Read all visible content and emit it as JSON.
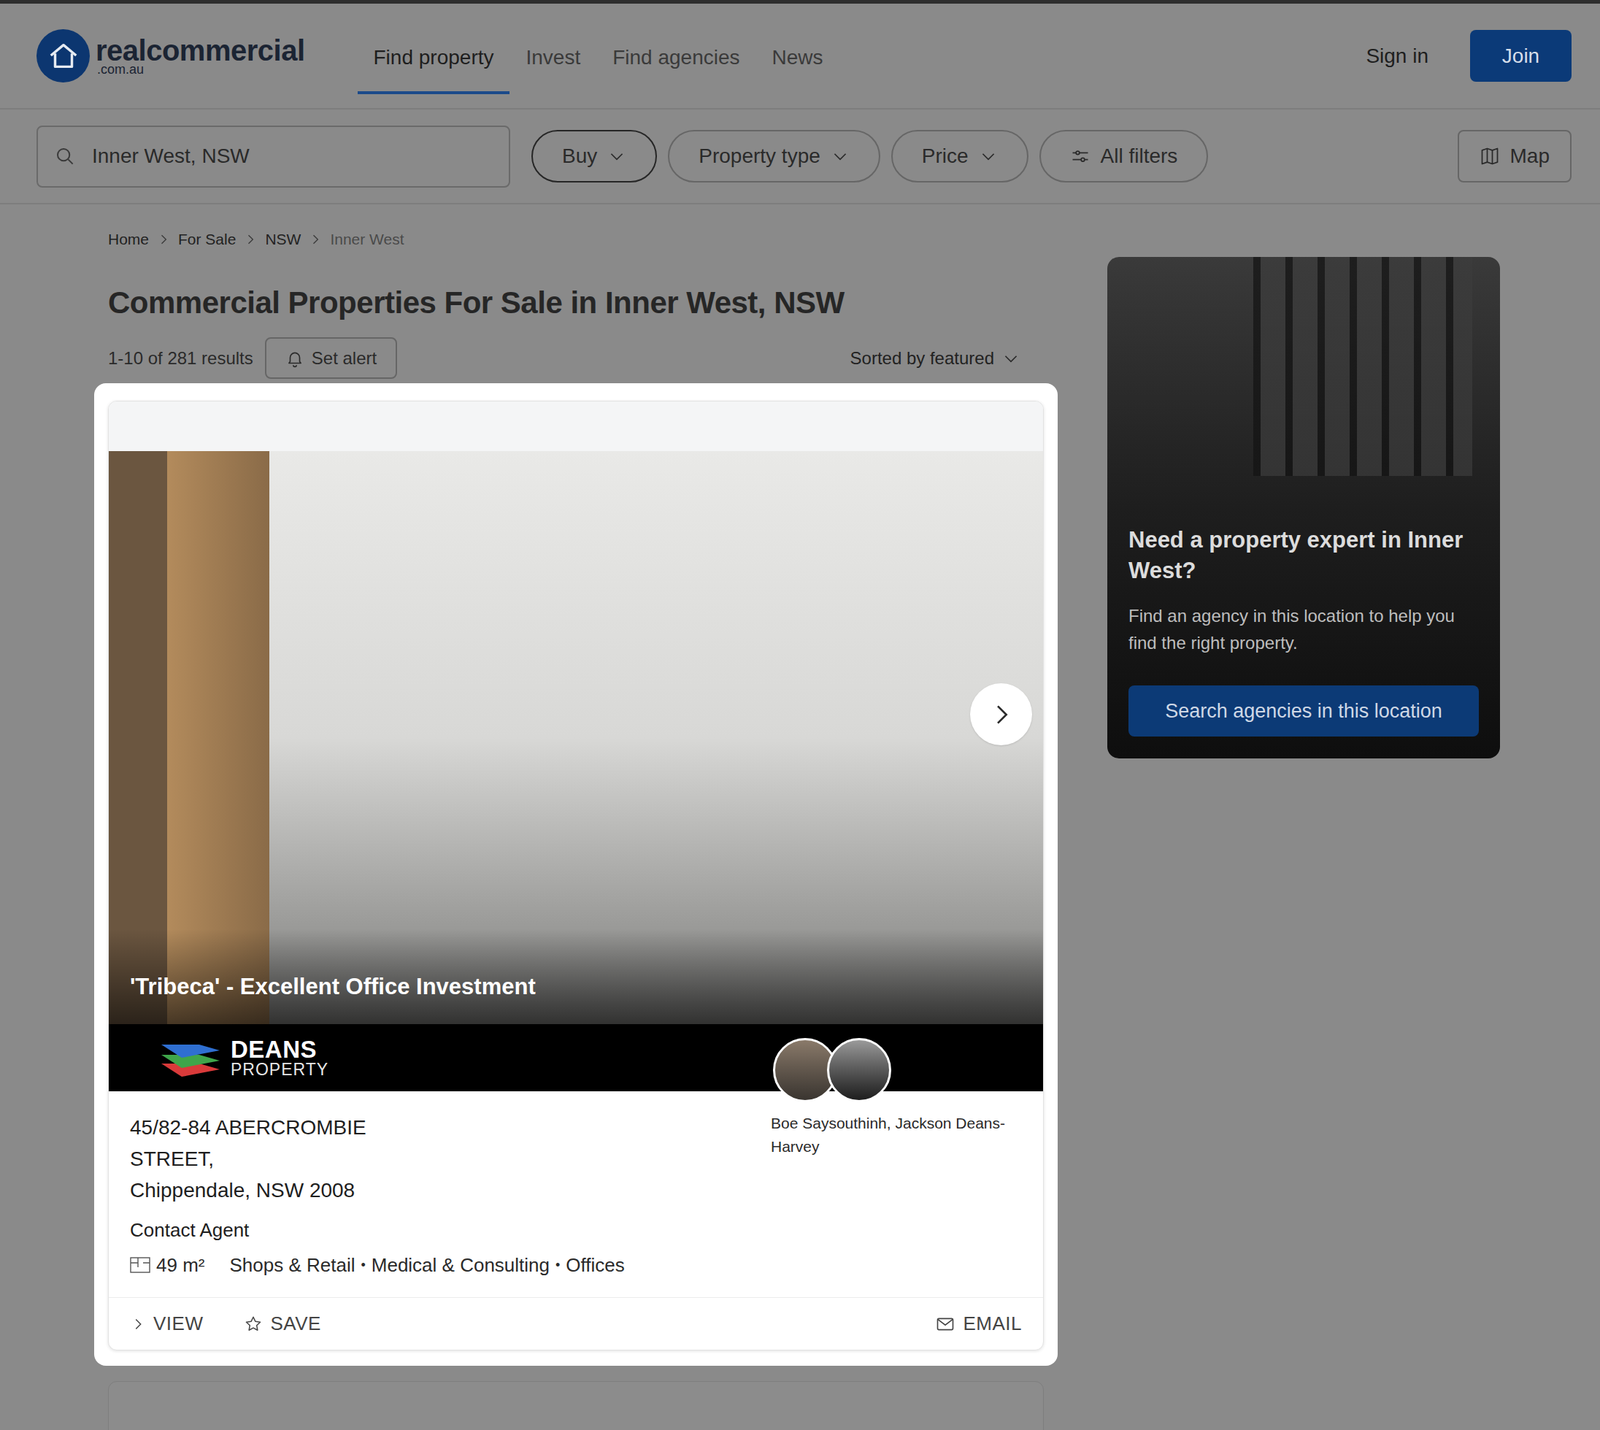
{
  "header": {
    "logo": {
      "name": "realcommercial",
      "domain": ".com.au"
    },
    "nav": [
      {
        "label": "Find property",
        "selected": true
      },
      {
        "label": "Invest",
        "selected": false
      },
      {
        "label": "Find agencies",
        "selected": false
      },
      {
        "label": "News",
        "selected": false
      }
    ],
    "sign_in": "Sign in",
    "join": "Join"
  },
  "filters": {
    "search": {
      "value": "Inner West, NSW"
    },
    "buttons": [
      {
        "label": "Buy",
        "kind": "dropdown",
        "selected": true
      },
      {
        "label": "Property type",
        "kind": "dropdown",
        "selected": false
      },
      {
        "label": "Price",
        "kind": "dropdown",
        "selected": false
      },
      {
        "label": "All filters",
        "kind": "filters",
        "selected": false
      }
    ],
    "map": "Map"
  },
  "breadcrumb": [
    {
      "label": "Home",
      "current": false
    },
    {
      "label": "For Sale",
      "current": false
    },
    {
      "label": "NSW",
      "current": false
    },
    {
      "label": "Inner West",
      "current": true
    }
  ],
  "heading": "Commercial Properties For Sale in Inner West, NSW",
  "results": {
    "count": "1-10 of 281 results",
    "set_alert": "Set alert",
    "sort": "Sorted by featured"
  },
  "listing": {
    "banner_title": "'Tribeca' - Excellent Office Investment",
    "agency": {
      "line1": "DEANS",
      "line2": "PROPERTY"
    },
    "agents": "Boe Saysouthinh, Jackson Deans-Harvey",
    "address": [
      "45/82-84 ABERCROMBIE",
      "STREET,",
      "Chippendale, NSW 2008"
    ],
    "price": "Contact Agent",
    "area": "49 m²",
    "separator": "•",
    "types": [
      "Shops & Retail",
      "Medical & Consulting",
      "Offices"
    ],
    "actions": {
      "view": "VIEW",
      "save": "SAVE",
      "email": "EMAIL"
    }
  },
  "sidebar": {
    "title": "Need a property expert in Inner West?",
    "body": "Find an agency in this location to help you find the right property.",
    "button": "Search agencies in this location"
  }
}
